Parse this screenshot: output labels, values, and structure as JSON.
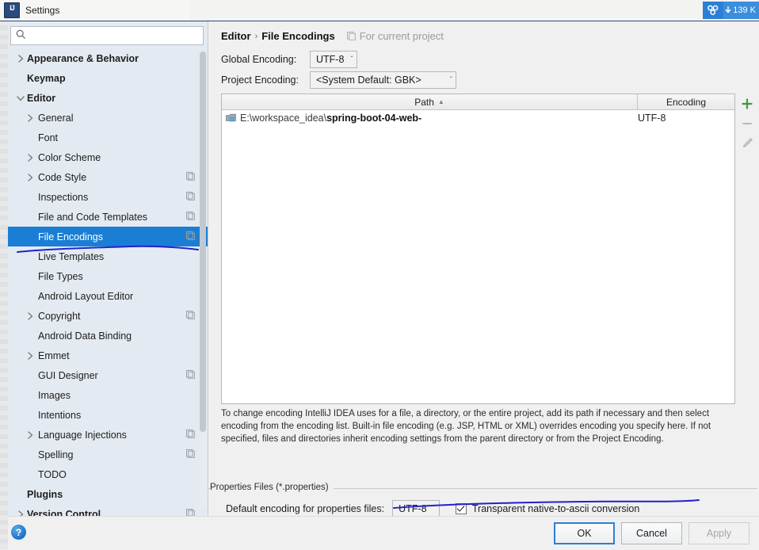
{
  "window": {
    "title": "Settings",
    "app_icon": "intellij-idea-icon",
    "network_badge": {
      "icon": "network-share-icon",
      "speed": "139 K"
    }
  },
  "sidebar": {
    "search": {
      "value": "",
      "placeholder": "",
      "icon": "search-icon"
    },
    "items": [
      {
        "label": "Appearance & Behavior",
        "level": 0,
        "bold": true,
        "arrow": "right",
        "copy": false,
        "selected": false
      },
      {
        "label": "Keymap",
        "level": 0,
        "bold": true,
        "arrow": "none",
        "copy": false,
        "selected": false
      },
      {
        "label": "Editor",
        "level": 0,
        "bold": true,
        "arrow": "down",
        "copy": false,
        "selected": false
      },
      {
        "label": "General",
        "level": 1,
        "bold": false,
        "arrow": "right",
        "copy": false,
        "selected": false
      },
      {
        "label": "Font",
        "level": 1,
        "bold": false,
        "arrow": "none",
        "copy": false,
        "selected": false
      },
      {
        "label": "Color Scheme",
        "level": 1,
        "bold": false,
        "arrow": "right",
        "copy": false,
        "selected": false
      },
      {
        "label": "Code Style",
        "level": 1,
        "bold": false,
        "arrow": "right",
        "copy": true,
        "selected": false
      },
      {
        "label": "Inspections",
        "level": 1,
        "bold": false,
        "arrow": "none",
        "copy": true,
        "selected": false
      },
      {
        "label": "File and Code Templates",
        "level": 1,
        "bold": false,
        "arrow": "none",
        "copy": true,
        "selected": false
      },
      {
        "label": "File Encodings",
        "level": 1,
        "bold": false,
        "arrow": "none",
        "copy": true,
        "selected": true
      },
      {
        "label": "Live Templates",
        "level": 1,
        "bold": false,
        "arrow": "none",
        "copy": false,
        "selected": false
      },
      {
        "label": "File Types",
        "level": 1,
        "bold": false,
        "arrow": "none",
        "copy": false,
        "selected": false
      },
      {
        "label": "Android Layout Editor",
        "level": 1,
        "bold": false,
        "arrow": "none",
        "copy": false,
        "selected": false
      },
      {
        "label": "Copyright",
        "level": 1,
        "bold": false,
        "arrow": "right",
        "copy": true,
        "selected": false
      },
      {
        "label": "Android Data Binding",
        "level": 1,
        "bold": false,
        "arrow": "none",
        "copy": false,
        "selected": false
      },
      {
        "label": "Emmet",
        "level": 1,
        "bold": false,
        "arrow": "right",
        "copy": false,
        "selected": false
      },
      {
        "label": "GUI Designer",
        "level": 1,
        "bold": false,
        "arrow": "none",
        "copy": true,
        "selected": false
      },
      {
        "label": "Images",
        "level": 1,
        "bold": false,
        "arrow": "none",
        "copy": false,
        "selected": false
      },
      {
        "label": "Intentions",
        "level": 1,
        "bold": false,
        "arrow": "none",
        "copy": false,
        "selected": false
      },
      {
        "label": "Language Injections",
        "level": 1,
        "bold": false,
        "arrow": "right",
        "copy": true,
        "selected": false
      },
      {
        "label": "Spelling",
        "level": 1,
        "bold": false,
        "arrow": "none",
        "copy": true,
        "selected": false
      },
      {
        "label": "TODO",
        "level": 1,
        "bold": false,
        "arrow": "none",
        "copy": false,
        "selected": false
      },
      {
        "label": "Plugins",
        "level": 0,
        "bold": true,
        "arrow": "none",
        "copy": false,
        "selected": false
      },
      {
        "label": "Version Control",
        "level": 0,
        "bold": true,
        "arrow": "right",
        "copy": true,
        "selected": false
      }
    ]
  },
  "main": {
    "breadcrumb": {
      "parent": "Editor",
      "separator": "›",
      "current": "File Encodings"
    },
    "scope_note": {
      "icon": "copy-scope-icon",
      "text": "For current project"
    },
    "global_encoding": {
      "label": "Global Encoding:",
      "value": "UTF-8",
      "chevron": "ˇ"
    },
    "project_encoding": {
      "label": "Project Encoding:",
      "value": "<System Default: GBK>",
      "chevron": "ˇ"
    },
    "table": {
      "columns": [
        {
          "key": "path",
          "label": "Path",
          "sorted": true,
          "sort_arrow": "▲"
        },
        {
          "key": "encoding",
          "label": "Encoding",
          "sorted": false,
          "sort_arrow": ""
        }
      ],
      "rows": [
        {
          "icon": "folder-module-icon",
          "path_prefix": "E:\\workspace_idea\\",
          "path_bold": "spring-boot-04-web-",
          "encoding": "UTF-8"
        }
      ],
      "buttons": [
        {
          "name": "add-path-button",
          "glyph": "+",
          "enabled": true
        },
        {
          "name": "remove-path-button",
          "glyph": "−",
          "enabled": false
        },
        {
          "name": "edit-path-button",
          "glyph": "pencil",
          "enabled": false
        }
      ]
    },
    "description": "To change encoding IntelliJ IDEA uses for a file, a directory, or the entire project, add its path if necessary and then select encoding from the encoding list. Built-in file encoding (e.g. JSP, HTML or XML) overrides encoding you specify here. If not specified, files and directories inherit encoding settings from the parent directory or from the Project Encoding.",
    "properties_group": {
      "title": "Properties Files (*.properties)",
      "default_encoding_label": "Default encoding for properties files:",
      "default_encoding_value": "UTF-8",
      "chevron": "ˇ",
      "transparent_conversion": {
        "label": "Transparent native-to-ascii conversion",
        "checked": true
      }
    }
  },
  "footer": {
    "help_label": "?",
    "ok_label": "OK",
    "cancel_label": "Cancel",
    "apply_label": "Apply"
  },
  "colors": {
    "accent_blue": "#1a7fd4",
    "selection_blue": "#1a7fd4",
    "ink_blue": "#2222cc",
    "add_green": "#3f9a3f",
    "sidebar_bg": "#e4eaf1",
    "panel_bg": "#f0f0f0"
  }
}
